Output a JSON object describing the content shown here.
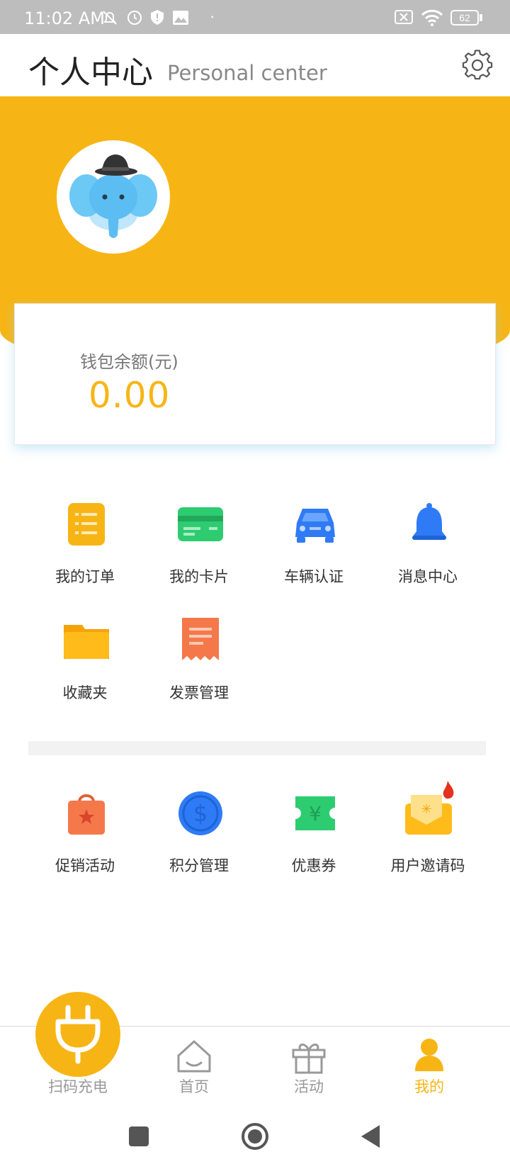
{
  "status_bar": {
    "time": "11:02 AM",
    "battery": "62"
  },
  "header": {
    "title": "个人中心",
    "subtitle": "Personal center",
    "settings_icon": "gear-icon"
  },
  "wallet": {
    "label": "钱包余额(元)",
    "balance": "0.00"
  },
  "services": [
    {
      "label": "我的订单",
      "icon": "order-icon",
      "color": "#f7b515"
    },
    {
      "label": "我的卡片",
      "icon": "card-icon",
      "color": "#2ecc71"
    },
    {
      "label": "车辆认证",
      "icon": "car-icon",
      "color": "#2f7bf5"
    },
    {
      "label": "消息中心",
      "icon": "bell-icon",
      "color": "#2f7bf5"
    },
    {
      "label": "收藏夹",
      "icon": "folder-icon",
      "color": "#f7b515"
    },
    {
      "label": "发票管理",
      "icon": "invoice-icon",
      "color": "#f5784a"
    }
  ],
  "promotions": [
    {
      "label": "促销活动",
      "icon": "shopping-bag-icon",
      "color": "#f5784a"
    },
    {
      "label": "积分管理",
      "icon": "dollar-coin-icon",
      "color": "#2f7bf5"
    },
    {
      "label": "优惠券",
      "icon": "coupon-icon",
      "color": "#2ecc71"
    },
    {
      "label": "用户邀请码",
      "icon": "invite-envelope-icon",
      "color": "#f7b515"
    }
  ],
  "bottom_nav": [
    {
      "label": "扫码充电",
      "icon": "plug-icon",
      "active": false
    },
    {
      "label": "首页",
      "icon": "home-icon",
      "active": false
    },
    {
      "label": "活动",
      "icon": "gift-icon",
      "active": false
    },
    {
      "label": "我的",
      "icon": "person-icon",
      "active": true
    }
  ],
  "colors": {
    "accent": "#f7b515",
    "inactive": "#999999"
  }
}
